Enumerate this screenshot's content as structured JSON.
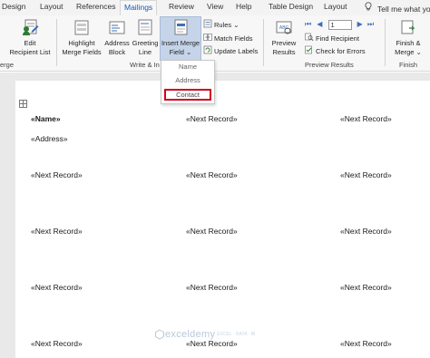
{
  "tabs": [
    {
      "label": "Design",
      "active": false
    },
    {
      "label": "Layout",
      "active": false
    },
    {
      "label": "References",
      "active": false
    },
    {
      "label": "Mailings",
      "active": true
    },
    {
      "label": "Review",
      "active": false
    },
    {
      "label": "View",
      "active": false
    },
    {
      "label": "Help",
      "active": false
    },
    {
      "label": "Table Design",
      "active": false
    },
    {
      "label": "Layout",
      "active": false
    }
  ],
  "tell_me": "Tell me what yo",
  "ribbon": {
    "edit_recipient": {
      "line1": "Edit",
      "line2": "Recipient List"
    },
    "start_merge_group": "erge",
    "highlight": {
      "line1": "Highlight",
      "line2": "Merge Fields"
    },
    "address_block": {
      "line1": "Address",
      "line2": "Block"
    },
    "greeting_line": {
      "line1": "Greeting",
      "line2": "Line"
    },
    "insert_merge": {
      "line1": "Insert Merge",
      "line2": "Field"
    },
    "rules": "Rules",
    "match_fields": "Match Fields",
    "update_labels": "Update Labels",
    "write_insert_group": "Write & In",
    "preview": {
      "line1": "Preview",
      "line2": "Results"
    },
    "record_number": "1",
    "find_recipient": "Find Recipient",
    "check_errors": "Check for Errors",
    "preview_group": "Preview Results",
    "finish": {
      "line1": "Finish &",
      "line2": "Merge"
    },
    "finish_group": "Finish"
  },
  "dropdown": {
    "items": [
      "Name",
      "Address",
      "Contact"
    ],
    "selected": "Contact"
  },
  "document": {
    "row1": {
      "col1_name": "«Name»",
      "col1_address": "«Address»",
      "col2": "«Next Record»",
      "col3": "«Next Record»"
    },
    "rows": [
      [
        "«Next Record»",
        "«Next Record»",
        "«Next Record»"
      ],
      [
        "«Next Record»",
        "«Next Record»",
        "«Next Record»"
      ],
      [
        "«Next Record»",
        "«Next Record»",
        "«Next Record»"
      ],
      [
        "«Next Record»",
        "«Next Record»",
        "«Next Record»"
      ]
    ]
  },
  "watermark": {
    "name": "exceldemy",
    "sub": "EXCEL · DATA · BI"
  },
  "colors": {
    "accent": "#185abd",
    "selected_outline": "#d0021b",
    "insert_merge_bg": "#c5d4e8"
  }
}
